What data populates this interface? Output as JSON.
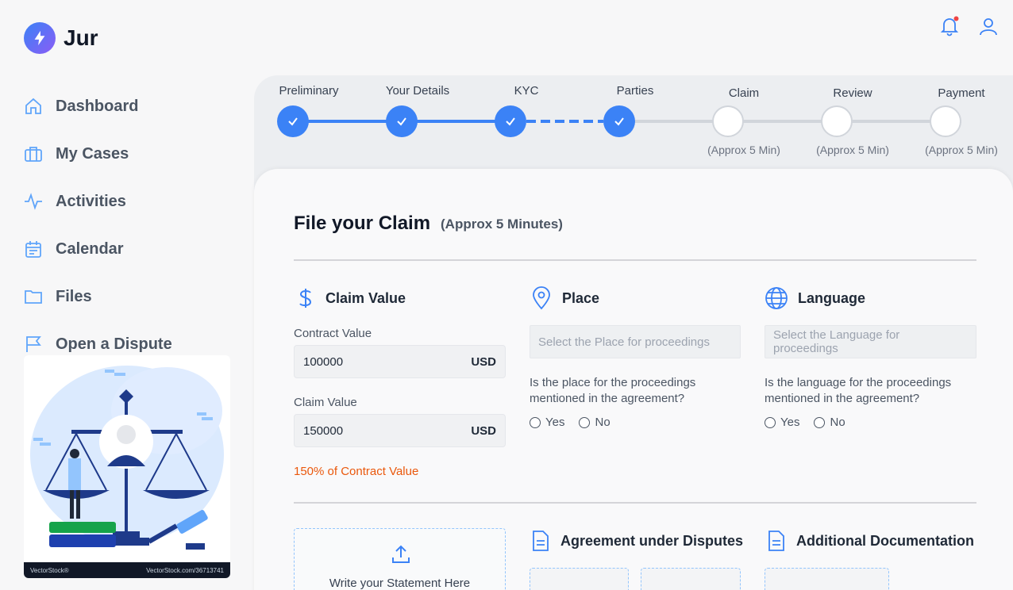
{
  "app": {
    "name": "Jur"
  },
  "sidebar": {
    "items": [
      {
        "label": "Dashboard",
        "icon": "home-icon"
      },
      {
        "label": "My Cases",
        "icon": "briefcase-icon"
      },
      {
        "label": "Activities",
        "icon": "activity-icon"
      },
      {
        "label": "Calendar",
        "icon": "calendar-icon"
      },
      {
        "label": "Files",
        "icon": "folder-icon"
      },
      {
        "label": "Open a Dispute",
        "icon": "flag-icon"
      }
    ]
  },
  "illustration": {
    "watermark_left": "VectorStock®",
    "watermark_right": "VectorStock.com/36713741"
  },
  "header": {
    "icons": [
      "bell-icon",
      "user-icon"
    ]
  },
  "stepper": {
    "steps": [
      {
        "label": "Preliminary",
        "status": "done",
        "sub": ""
      },
      {
        "label": "Your Details",
        "status": "done",
        "sub": ""
      },
      {
        "label": "KYC",
        "status": "done",
        "sub": ""
      },
      {
        "label": "Parties",
        "status": "done",
        "sub": ""
      },
      {
        "label": "Claim",
        "status": "todo",
        "sub": "(Approx 5 Min)"
      },
      {
        "label": "Review",
        "status": "todo",
        "sub": "(Approx 5 Min)"
      },
      {
        "label": "Payment",
        "status": "todo",
        "sub": "(Approx 5 Min)"
      }
    ]
  },
  "claim": {
    "title": "File your Claim",
    "subtitle": "(Approx 5 Minutes)",
    "claim_value": {
      "heading": "Claim Value",
      "contract_label": "Contract Value",
      "contract_value": "100000",
      "contract_currency": "USD",
      "claim_label": "Claim Value",
      "claim_value": "150000",
      "claim_currency": "USD",
      "note": "150% of Contract Value"
    },
    "place": {
      "heading": "Place",
      "placeholder": "Select the Place for proceedings",
      "question": "Is the place for the proceedings mentioned in the agreement?",
      "yes": "Yes",
      "no": "No"
    },
    "language": {
      "heading": "Language",
      "placeholder": "Select the Language for proceedings",
      "question": "Is the language for the proceedings mentioned in the agreement?",
      "yes": "Yes",
      "no": "No"
    },
    "statement": {
      "label": "Write your Statement Here"
    },
    "agreement": {
      "heading": "Agreement under Disputes"
    },
    "additional": {
      "heading": "Additional Documentation"
    }
  },
  "colors": {
    "accent": "#3b82f6",
    "note": "#ea580c"
  }
}
